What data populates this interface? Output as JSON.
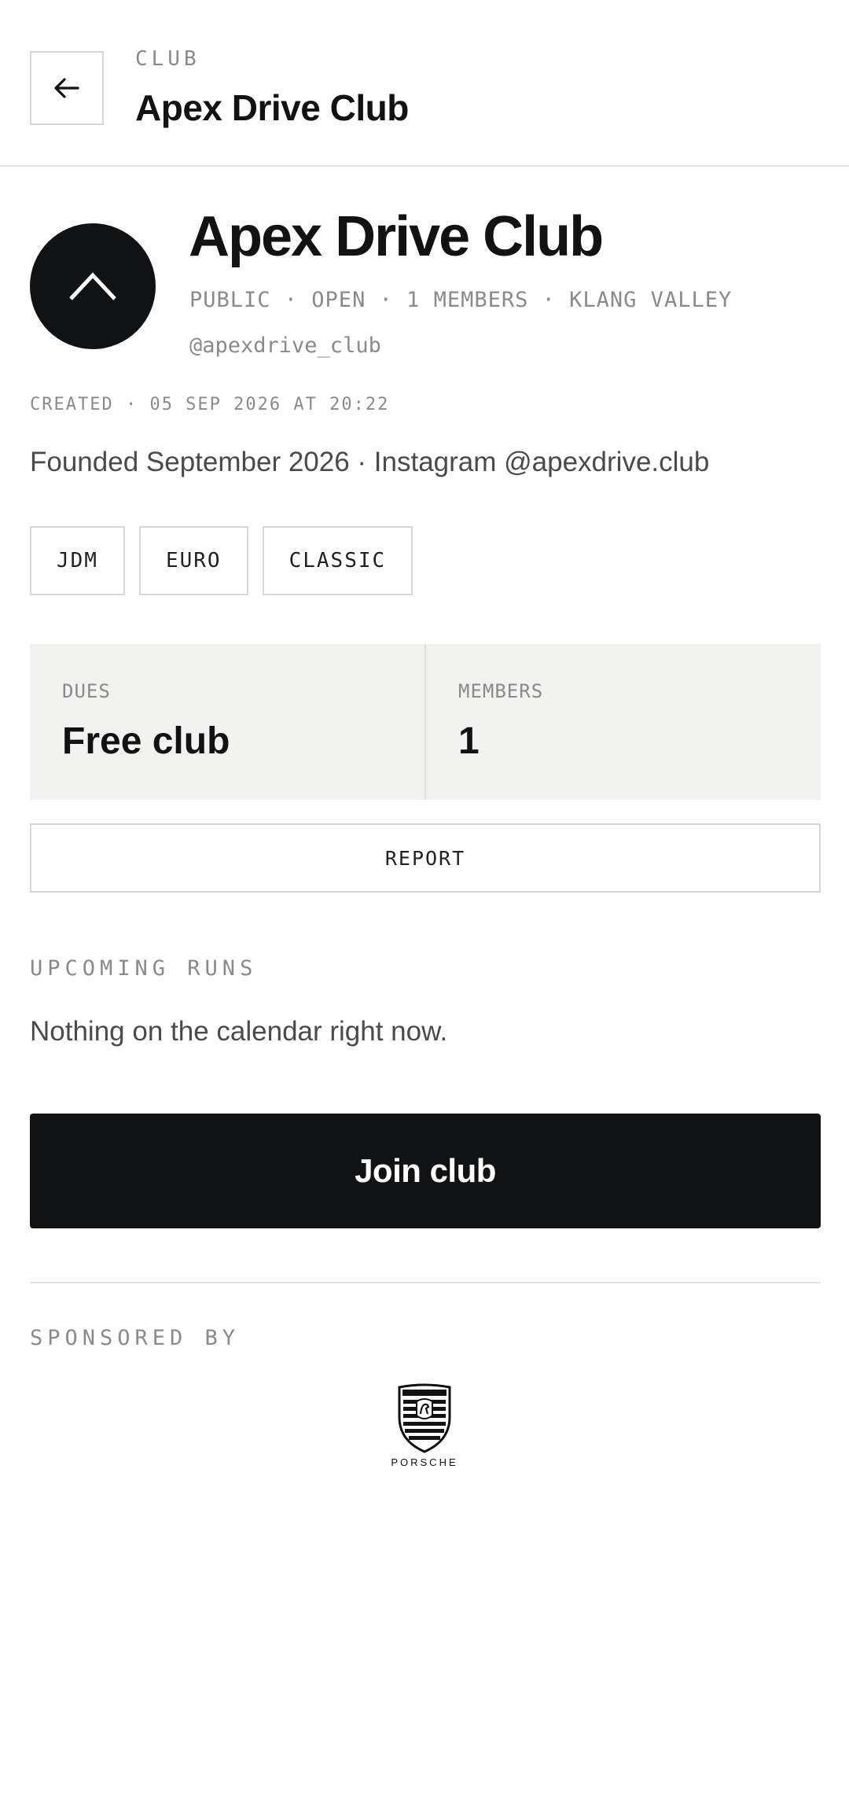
{
  "header": {
    "kicker": "CLUB",
    "title": "Apex Drive Club"
  },
  "club": {
    "name": "Apex Drive Club",
    "meta": "PUBLIC · OPEN · 1 MEMBERS · KLANG VALLEY",
    "handle": "@apexdrive_club",
    "created": "CREATED · 05 SEP 2026 AT 20:22",
    "description": "Founded September 2026 · Instagram @apexdrive.club",
    "tags": [
      "JDM",
      "EURO",
      "CLASSIC"
    ]
  },
  "stats": {
    "dues_label": "DUES",
    "dues_value": "Free club",
    "members_label": "MEMBERS",
    "members_value": "1"
  },
  "actions": {
    "report_label": "REPORT",
    "join_label": "Join club"
  },
  "upcoming": {
    "label": "UPCOMING RUNS",
    "empty_text": "Nothing on the calendar right now."
  },
  "sponsors": {
    "label": "SPONSORED BY",
    "items": [
      {
        "name": "PORSCHE",
        "icon": "porsche-crest-logo"
      }
    ]
  },
  "icons": {
    "back": "arrow-left-icon",
    "avatar": "chevron-up-icon"
  },
  "colors": {
    "primary": "#111214",
    "muted_text": "#8a8a8a",
    "stat_bg": "#f2f2f1",
    "border": "#d8d8d8"
  }
}
